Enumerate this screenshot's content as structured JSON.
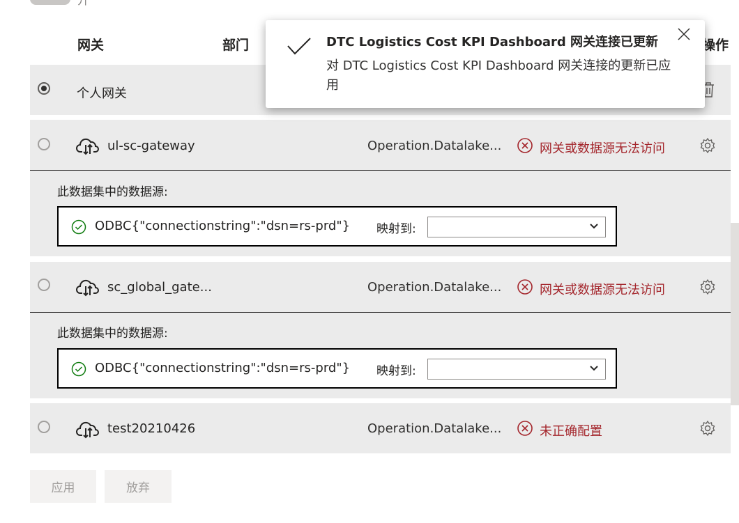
{
  "top_toggle": {
    "label": "开"
  },
  "header": {
    "gateway": "网关",
    "department": "部门",
    "actions_partial": "操作"
  },
  "rows": [
    {
      "name": "个人网关",
      "department": "",
      "status": "",
      "selected": true
    },
    {
      "name": "ul-sc-gateway",
      "department": "Operation.Datalake...",
      "status": "网关或数据源无法访问",
      "selected": false
    },
    {
      "name": "sc_global_gate...",
      "department": "Operation.Datalake...",
      "status": "网关或数据源无法访问",
      "selected": false
    },
    {
      "name": "test20210426",
      "department": "Operation.Datalake...",
      "status": "未正确配置",
      "selected": false
    }
  ],
  "datasource_panels": [
    {
      "title": "此数据集中的数据源:",
      "source": "ODBC{\"connectionstring\":\"dsn=rs-prd\"}",
      "map_label": "映射到:",
      "selected_value": ""
    },
    {
      "title": "此数据集中的数据源:",
      "source": "ODBC{\"connectionstring\":\"dsn=rs-prd\"}",
      "map_label": "映射到:",
      "selected_value": ""
    }
  ],
  "buttons": {
    "apply": "应用",
    "discard": "放弃"
  },
  "toast": {
    "title": "DTC Logistics Cost KPI Dashboard 网关连接已更新",
    "body": "对 DTC Logistics Cost KPI Dashboard 网关连接的更新已应用"
  },
  "icons": {
    "check": "checkmark-icon",
    "close": "close-icon",
    "cloud": "cloud-gateway-icon",
    "gear": "gear-icon",
    "error": "error-circle-icon",
    "ok": "success-circle-icon",
    "trash": "trash-icon",
    "chevron": "chevron-down-icon"
  },
  "colors": {
    "error": "#a4262c",
    "success": "#107c10",
    "row_bg": "#ebebeb"
  }
}
